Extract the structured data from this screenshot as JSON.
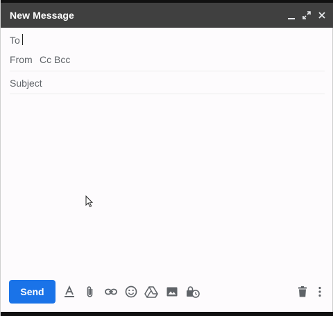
{
  "titlebar": {
    "title": "New Message",
    "buttons": [
      "minimize-icon",
      "expand-icon",
      "close-icon"
    ]
  },
  "fields": {
    "to_label": "To",
    "from_label": "From",
    "cc_bcc_label": "Cc Bcc",
    "subject_placeholder": "Subject"
  },
  "toolbar": {
    "send_label": "Send",
    "icons": [
      "text-format-icon",
      "attach-icon",
      "link-icon",
      "emoji-icon",
      "drive-icon",
      "image-icon",
      "confidential-mode-icon",
      "trash-icon",
      "more-options-icon"
    ]
  },
  "colors": {
    "titlebar_bg": "#404040",
    "send_bg": "#1a73e8",
    "icon_gray": "#5f6368"
  }
}
